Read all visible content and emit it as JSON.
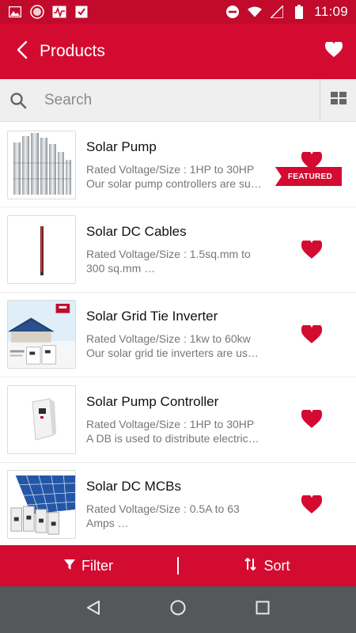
{
  "status_bar": {
    "time": "11:09",
    "left_icons": [
      "image-icon",
      "record-icon",
      "activity-icon",
      "download-icon"
    ],
    "right_icons": [
      "do-not-disturb-icon",
      "wifi-icon",
      "signal-icon",
      "battery-icon"
    ]
  },
  "app_bar": {
    "title": "Products",
    "back_icon": "chevron-left-icon",
    "favorite_icon": "heart-icon"
  },
  "search": {
    "placeholder": "Search",
    "value": "",
    "view_toggle_icon": "grid-icon"
  },
  "products": [
    {
      "name": "Solar Pump",
      "line1": "Rated Voltage/Size : 1HP to 30HP",
      "line2": "Our solar pump controllers are su…",
      "badge": "FEATURED",
      "favorite": true
    },
    {
      "name": "Solar DC Cables",
      "line1": "Rated Voltage/Size : 1.5sq.mm to",
      "line2": "300 sq.mm …",
      "badge": "",
      "favorite": true
    },
    {
      "name": "Solar Grid Tie Inverter",
      "line1": "Rated Voltage/Size : 1kw to 60kw",
      "line2": "Our solar grid tie inverters are us…",
      "badge": "",
      "favorite": true
    },
    {
      "name": "Solar Pump Controller",
      "line1": "Rated Voltage/Size : 1HP to 30HP",
      "line2": "A DB is used to distribute electric…",
      "badge": "",
      "favorite": true
    },
    {
      "name": "Solar DC MCBs",
      "line1": "Rated Voltage/Size : 0.5A to 63",
      "line2": "Amps …",
      "badge": "",
      "favorite": true
    }
  ],
  "bottom_bar": {
    "filter_label": "Filter",
    "sort_label": "Sort"
  },
  "colors": {
    "primary": "#d40b31",
    "status_bar": "#c20a2c",
    "nav_bar": "#555759"
  }
}
